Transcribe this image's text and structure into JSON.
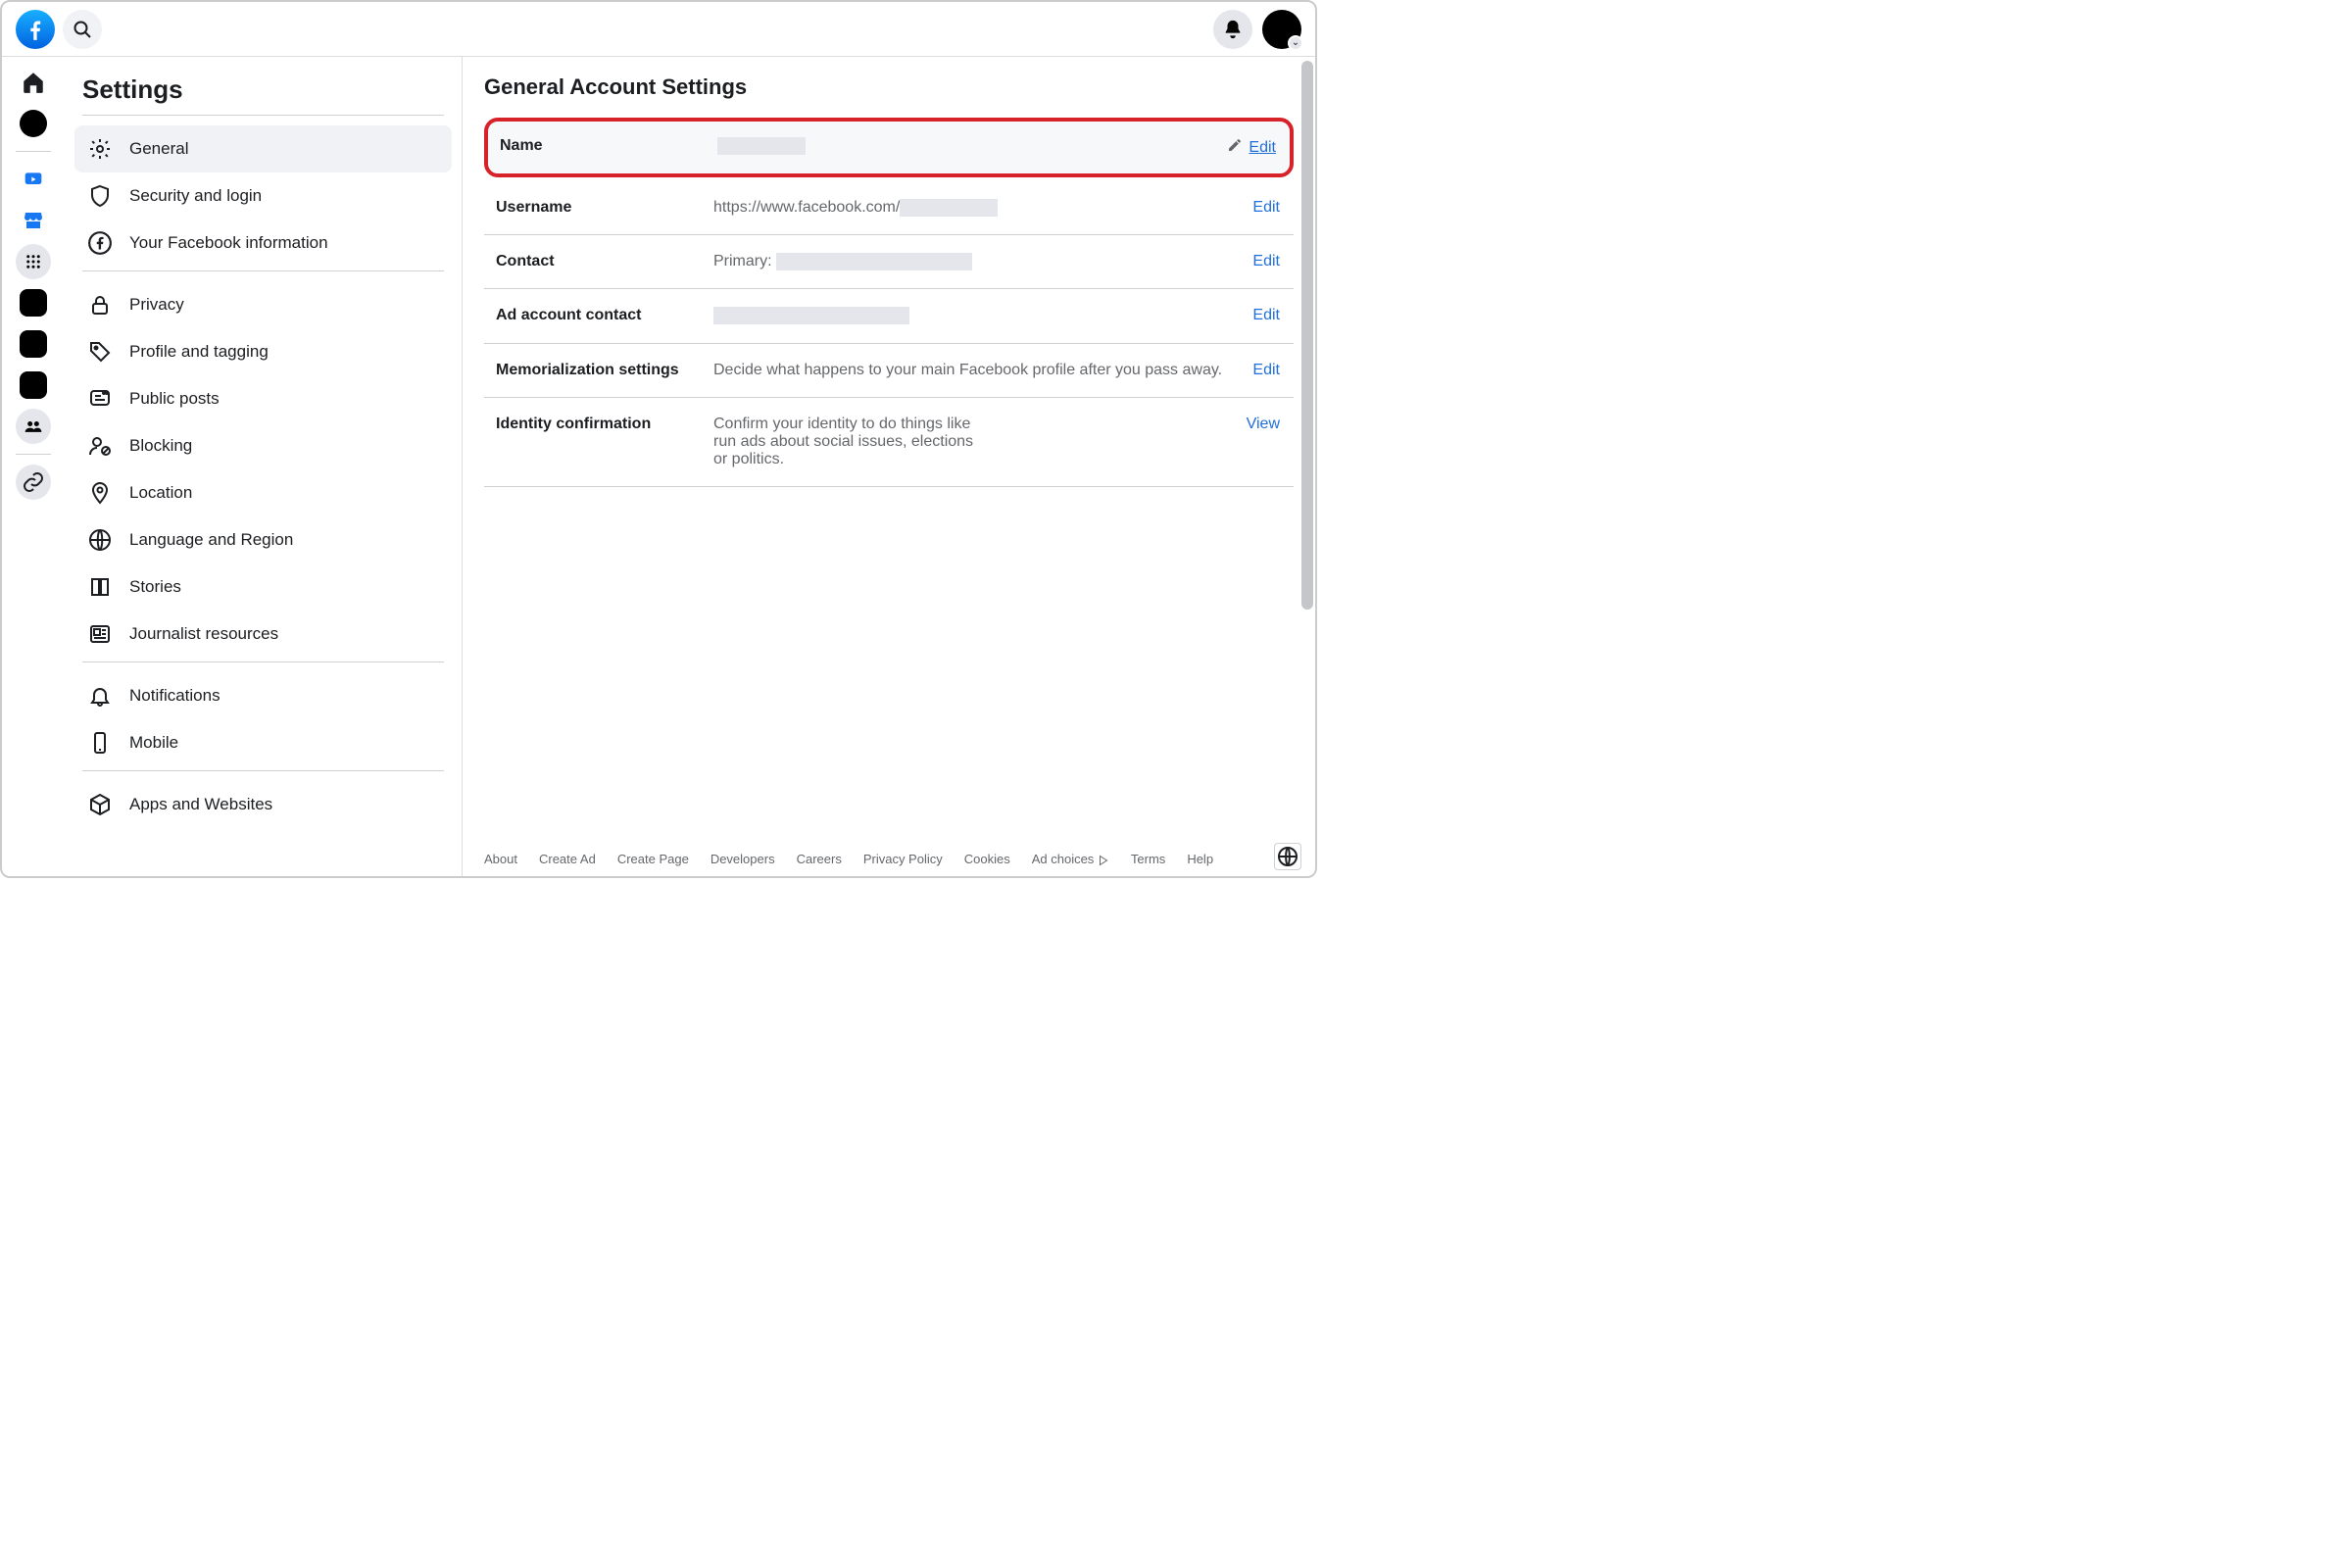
{
  "sidebar": {
    "title": "Settings",
    "groups": [
      [
        {
          "label": "General",
          "icon": "gear",
          "active": true
        },
        {
          "label": "Security and login",
          "icon": "shield"
        },
        {
          "label": "Your Facebook information",
          "icon": "fb-circle"
        }
      ],
      [
        {
          "label": "Privacy",
          "icon": "lock"
        },
        {
          "label": "Profile and tagging",
          "icon": "tag"
        },
        {
          "label": "Public posts",
          "icon": "posts"
        },
        {
          "label": "Blocking",
          "icon": "user-block"
        },
        {
          "label": "Location",
          "icon": "pin"
        },
        {
          "label": "Language and Region",
          "icon": "globe"
        },
        {
          "label": "Stories",
          "icon": "book"
        },
        {
          "label": "Journalist resources",
          "icon": "news"
        }
      ],
      [
        {
          "label": "Notifications",
          "icon": "bell"
        },
        {
          "label": "Mobile",
          "icon": "phone"
        }
      ],
      [
        {
          "label": "Apps and Websites",
          "icon": "cube"
        }
      ]
    ]
  },
  "main": {
    "title": "General Account Settings",
    "rows": [
      {
        "key": "name",
        "label": "Name",
        "value": "",
        "redacted_w": 90,
        "action": "Edit",
        "highlighted": true,
        "show_pencil": true
      },
      {
        "key": "username",
        "label": "Username",
        "value_prefix": "https://www.facebook.com/",
        "redacted_w": 100,
        "action": "Edit"
      },
      {
        "key": "contact",
        "label": "Contact",
        "value_prefix": "Primary: ",
        "redacted_w": 200,
        "action": "Edit"
      },
      {
        "key": "ad-contact",
        "label": "Ad account contact",
        "value": "",
        "redacted_w": 200,
        "action": "Edit"
      },
      {
        "key": "memorialization",
        "label": "Memorialization settings",
        "value": "Decide what happens to your main Facebook profile after you pass away.",
        "action": "Edit"
      },
      {
        "key": "identity",
        "label": "Identity confirmation",
        "value": "Confirm your identity to do things like run ads about social issues, elections or politics.",
        "action": "View",
        "narrow": true
      }
    ]
  },
  "footer": [
    "About",
    "Create Ad",
    "Create Page",
    "Developers",
    "Careers",
    "Privacy Policy",
    "Cookies",
    "Ad choices",
    "Terms",
    "Help"
  ]
}
